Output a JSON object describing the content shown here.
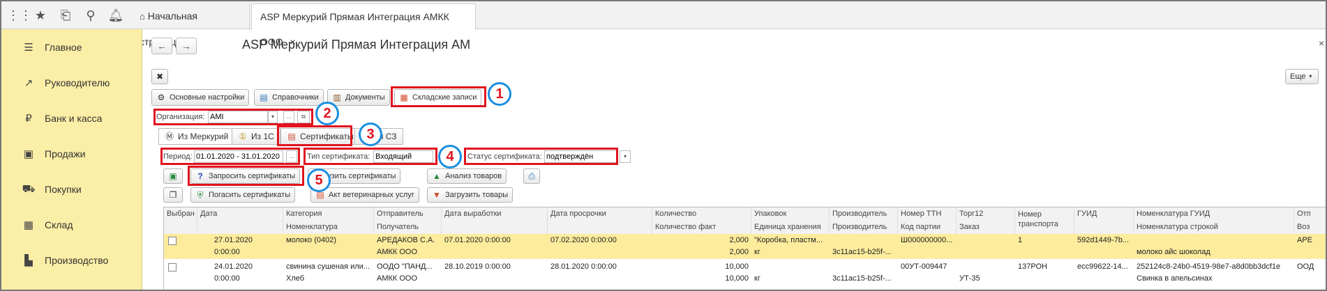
{
  "topbar": {
    "icons": [
      "apps-grid-icon",
      "star-icon",
      "history-icon",
      "search-icon",
      "bell-icon",
      "home-icon"
    ],
    "tabs": [
      "Начальная страница",
      "ASP Меркурий Прямая Интеграция АМКК ООО"
    ],
    "tab_close": "×"
  },
  "sidebar": {
    "items": [
      {
        "label": "Главное",
        "icon": "menu-icon",
        "glyph": "☰"
      },
      {
        "label": "Руководителю",
        "icon": "chart-icon",
        "glyph": "↗"
      },
      {
        "label": "Банк и касса",
        "icon": "ruble-icon",
        "glyph": "₽"
      },
      {
        "label": "Продажи",
        "icon": "bag-icon",
        "glyph": "▣"
      },
      {
        "label": "Покупки",
        "icon": "cart-icon",
        "glyph": "⛟"
      },
      {
        "label": "Склад",
        "icon": "warehouse-icon",
        "glyph": "▦"
      },
      {
        "label": "Производство",
        "icon": "factory-icon",
        "glyph": "▙"
      }
    ]
  },
  "header": {
    "back": "←",
    "forward": "→",
    "title": "ASP Меркурий Прямая Интеграция АМ",
    "close": "×",
    "more_label": "Еще"
  },
  "main_tabs": [
    {
      "label": "Основные настройки",
      "glyph": "⚙"
    },
    {
      "label": "Справочники",
      "glyph": "▤"
    },
    {
      "label": "Документы",
      "glyph": "▥"
    },
    {
      "label": "Складские записи",
      "glyph": "▦"
    }
  ],
  "org": {
    "label": "Организация:",
    "value": "AMI",
    "btn_dots": "...",
    "btn_open": "⧉"
  },
  "sub_tabs": [
    {
      "label": "Из Меркурий",
      "glyph": "Ⓜ"
    },
    {
      "label": "Из 1С",
      "glyph": "①"
    },
    {
      "label": "Сертификаты",
      "glyph": "▤"
    },
    {
      "label": "ии СЗ",
      "glyph": "▦"
    }
  ],
  "filters": {
    "period_label": "Период:",
    "period_value": "01.01.2020 - 31.01.2020",
    "period_btn": "...",
    "type_label": "Тип сертификата:",
    "type_value": "Входящий",
    "status_label": "Статус сертификата:",
    "status_value": "подтверждён",
    "dd": "▾"
  },
  "actions": {
    "request": "Запросить сертификаты",
    "load": "загрузить сертификаты",
    "analyze": "Анализ товаров",
    "repay": "Погасить сертификаты",
    "vet_act": "Акт ветеринарных услуг",
    "load_goods": "Загрузить товары"
  },
  "markers": [
    "1",
    "2",
    "3",
    "4",
    "5"
  ],
  "table": {
    "headers_top": [
      "Выбран",
      "Дата",
      "Категория",
      "Отправитель",
      "Дата выработки",
      "Дата просрочки",
      "Количество",
      "Упаковок",
      "Производитель",
      "Номер ТТН",
      "Торг12",
      "Номер транспорта",
      "ГУИД",
      "Номенклатура ГУИД",
      "Отп"
    ],
    "headers_bottom": [
      "",
      "",
      "Номенклатура",
      "Получатель",
      "",
      "",
      "Количество факт",
      "Единица хранения",
      "Производитель",
      "Код партии",
      "Заказ",
      "",
      "",
      "Номенклатура строкой",
      "Воз"
    ],
    "rows": [
      {
        "top": [
          "",
          "27.01.2020",
          "молоко (0402)",
          "АРЕДАКОВ С.А.",
          "07.01.2020 0:00:00",
          "07.02.2020 0:00:00",
          "2,000",
          "\"Коробка, пластм...",
          "",
          "Ш000000000...",
          "",
          "1",
          "592d1449-7b...",
          "",
          "АРЕ"
        ],
        "bottom": [
          "",
          "0:00:00",
          "",
          "АМКК ООО",
          "",
          "",
          "2,000",
          "кг",
          "3c11ac15-b25f-...",
          "",
          "",
          "",
          "",
          "молоко айс шоколад",
          ""
        ]
      },
      {
        "top": [
          "",
          "24.01.2020",
          "свинина сушеная или...",
          "ООДО \"ПАНД...",
          "28.10.2019 0:00:00",
          "28.01.2020 0:00:00",
          "10,000",
          "",
          "",
          "00УТ-009447",
          "",
          "137РОН",
          "ecc99622-14...",
          "252124c8-24b0-4519-98e7-a8d0bb3dcf1e",
          "ООД"
        ],
        "bottom": [
          "",
          "0:00:00",
          "Хлеб",
          "АМКК ООО",
          "",
          "",
          "10,000",
          "кг",
          "3c11ac15-b25f-...",
          "",
          "УТ-35",
          "",
          "",
          "Свинка в апельсинах",
          ""
        ]
      }
    ]
  }
}
